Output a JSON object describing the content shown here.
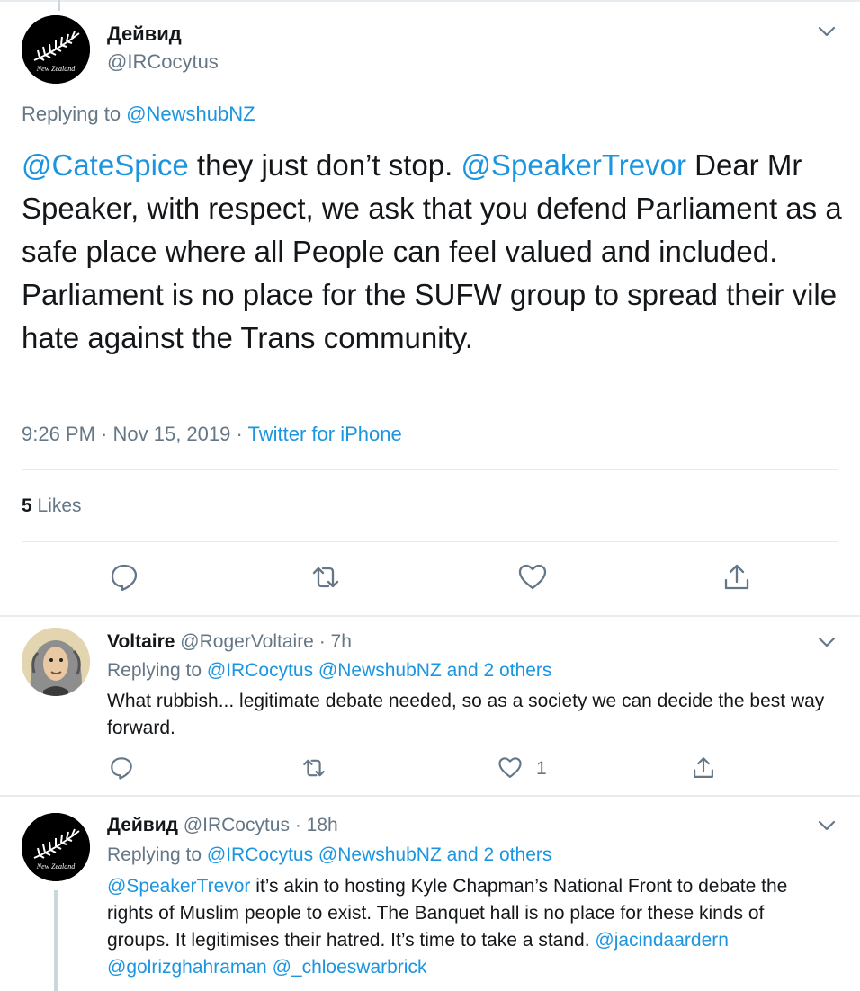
{
  "main_tweet": {
    "author_name": "Дейвид",
    "author_handle": "@IRCocytus",
    "avatar_text": "New Zealand",
    "replying_prefix": "Replying to ",
    "replying_to": "@NewshubNZ",
    "text_parts": {
      "mention1": "@CateSpice",
      "text1": " they just don’t stop. ",
      "mention2": "@SpeakerTrevor",
      "text2": " Dear Mr Speaker, with respect, we ask that you defend Parliament as a safe place where all People can feel valued and included. Parliament is no place for the SUFW group to spread their vile hate against the Trans community."
    },
    "time": "9:26 PM · Nov 15, 2019 · ",
    "source": "Twitter for iPhone",
    "likes_count": "5",
    "likes_label": " Likes"
  },
  "replies": [
    {
      "author_name": "Voltaire",
      "author_handle": " @RogerVoltaire · 7h",
      "replying_prefix": "Replying to ",
      "replying_to": "@IRCocytus @NewshubNZ and 2 others",
      "text": "What rubbish... legitimate debate needed, so as a society we can decide the best way forward.",
      "like_count": "1"
    },
    {
      "author_name": "Дейвид",
      "author_handle": " @IRCocytus · 18h",
      "avatar_text": "New Zealand",
      "replying_prefix": "Replying to ",
      "replying_to": "@IRCocytus @NewshubNZ and 2 others",
      "mention_start": "@SpeakerTrevor",
      "text": " it’s akin to hosting Kyle Chapman’s National Front to debate the rights of Muslim people to exist. The Banquet hall is no place for these kinds of groups. It legitimises their hatred. It’s time to take a stand. ",
      "mentions_end": "@jacindaardern @golrizghahraman @_chloeswarbrick"
    }
  ],
  "colors": {
    "link": "#1b95e0",
    "muted": "#657786",
    "text": "#14171a",
    "divider": "#e6ecf0"
  },
  "icons": [
    "chevron-down-icon",
    "reply-icon",
    "retweet-icon",
    "like-icon",
    "share-icon",
    "silver-fern-icon"
  ]
}
